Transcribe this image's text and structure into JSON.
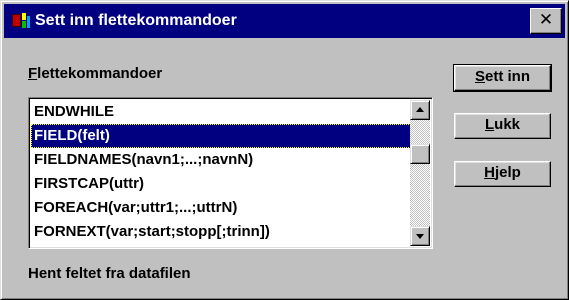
{
  "window": {
    "title": "Sett inn flettekommandoer",
    "close_glyph": "✕"
  },
  "list": {
    "label_accel": "F",
    "label_rest": "lettekommandoer",
    "selected_index": 1,
    "scroll_fraction": 0.28,
    "items": [
      {
        "label": "ENDWHILE"
      },
      {
        "label": "FIELD(felt)"
      },
      {
        "label": "FIELDNAMES(navn1;...;navnN)"
      },
      {
        "label": "FIRSTCAP(uttr)"
      },
      {
        "label": "FOREACH(var;uttr1;...;uttrN)"
      },
      {
        "label": "FORNEXT(var;start;stopp[;trinn])"
      }
    ]
  },
  "buttons": {
    "insert": {
      "accel": "S",
      "rest": "ett inn"
    },
    "close": {
      "accel": "L",
      "rest": "ukk"
    },
    "help": {
      "accel": "H",
      "rest": "jelp"
    }
  },
  "description": "Hent feltet fra datafilen",
  "icons": {
    "app": "wordperfect-merge-icon",
    "close": "close-icon",
    "scroll_up": "arrow-up-icon",
    "scroll_down": "arrow-down-icon"
  },
  "colors": {
    "titlebar": "#000080",
    "selection": "#000080",
    "face": "#c0c0c0"
  }
}
